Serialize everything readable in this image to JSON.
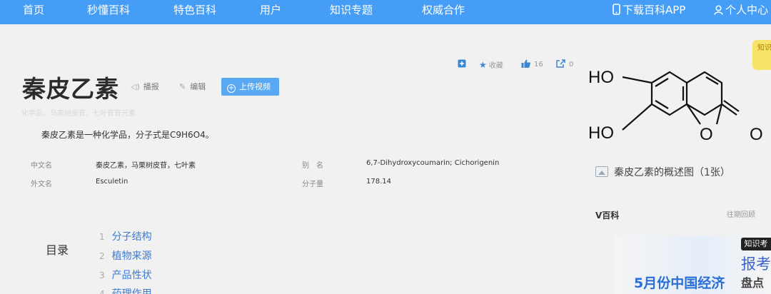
{
  "nav": {
    "items": [
      "首页",
      "秒懂百科",
      "特色百科",
      "用户",
      "知识专题",
      "权威合作"
    ],
    "download_app": "下载百科APP",
    "personal_center": "个人中心"
  },
  "entry": {
    "title": "秦皮乙素",
    "tools": {
      "play": "播报",
      "edit": "编辑",
      "upload_video": "上传视频"
    },
    "subtitle_faded": "化学品、马栗树皮苷、七叶苷苷元素",
    "summary": "秦皮乙素是一种化学品，分子式是C9H6O4。",
    "actions": {
      "favorite": "收藏",
      "likes": "16",
      "shares": "0"
    }
  },
  "basic_info": [
    {
      "label": "中文名",
      "value": "秦皮乙素，马栗树皮苷，七叶素"
    },
    {
      "label": "外文名",
      "value": "Esculetin"
    },
    {
      "label": "别　名",
      "value": "6,7-Dihydroxycoumarin; Cichorigenin"
    },
    {
      "label": "分子量",
      "value": "178.14"
    }
  ],
  "toc": {
    "title": "目录",
    "items": [
      {
        "num": "1",
        "label": "分子结构"
      },
      {
        "num": "2",
        "label": "植物来源"
      },
      {
        "num": "3",
        "label": "产品性状"
      },
      {
        "num": "4",
        "label": "药理作用"
      }
    ]
  },
  "sidebar": {
    "molecule_labels": {
      "ho_top": "HO",
      "ho_bottom": "HO",
      "o_ring": "O",
      "o_carbonyl": "O"
    },
    "gallery_caption": "秦皮乙素的概述图（1张）",
    "v_baike": "V百科",
    "past_link": "往期回顾",
    "promo": {
      "main": "5月份中国经济",
      "badge": "知识考",
      "big1": "报考",
      "big2": "盘点"
    },
    "side_tab": "知识百科"
  },
  "icons": [
    "phone-icon",
    "user-icon",
    "speaker-icon",
    "pencil-icon",
    "plus-circle-icon",
    "add-square-icon",
    "star-icon",
    "thumbs-up-icon",
    "share-icon",
    "picture-icon"
  ],
  "colors": {
    "nav_bg": "#459df5",
    "link": "#3a7bd5",
    "upload_btn": "#59a8f2",
    "page_bg": "#f1f1f1"
  }
}
